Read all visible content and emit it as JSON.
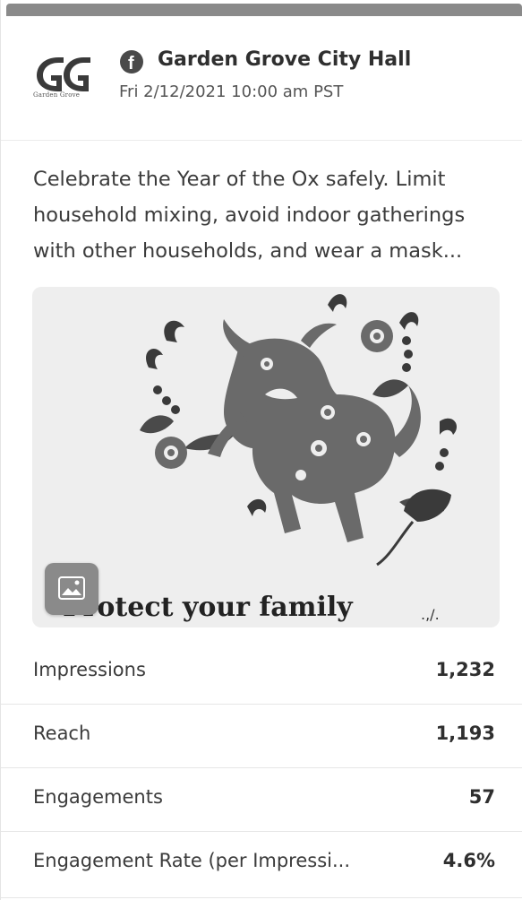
{
  "header": {
    "account_name": "Garden Grove City Hall",
    "post_time": "Fri 2/12/2021 10:00 am PST",
    "logo_text": "Garden Grove",
    "logo_letters": "GG",
    "network_icon": "facebook-icon"
  },
  "post": {
    "text_lines": [
      "Celebrate the Year of the Ox safely. Limit",
      "household mixing, avoid indoor gatherings",
      "with other households, and wear a mask..."
    ],
    "media_caption": "Protect your family",
    "media_caption_tail": ".,/.",
    "media_type_icon": "image-icon"
  },
  "metrics": [
    {
      "label": "Impressions",
      "value": "1,232"
    },
    {
      "label": "Reach",
      "value": "1,193"
    },
    {
      "label": "Engagements",
      "value": "57"
    },
    {
      "label": "Engagement Rate (per Impressi...",
      "value": "4.6%"
    }
  ],
  "colors": {
    "dark": "#2f2f2f",
    "ox": "#6a6a6a",
    "badge": "#8a8a8a"
  }
}
